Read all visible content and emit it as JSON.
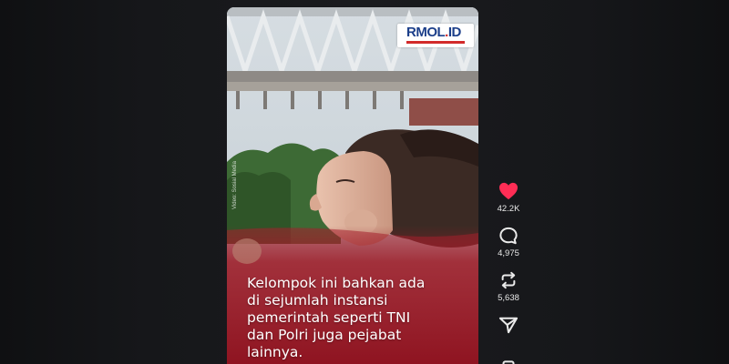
{
  "video": {
    "logo": {
      "main": "RMOL",
      "dot": ".",
      "suffix": "ID"
    },
    "watermark": "Video: Sosial Media",
    "caption_lines": [
      "Kelompok ini bahkan ada",
      "di sejumlah instansi",
      "pemerintah seperti TNI",
      "dan Polri juga pejabat",
      "lainnya."
    ]
  },
  "actions": {
    "like": {
      "icon": "heart-icon",
      "count": "42.2K",
      "color": "#ff2d55"
    },
    "comment": {
      "icon": "comment-icon",
      "count": "4,975"
    },
    "repost": {
      "icon": "repost-icon",
      "count": "5,638"
    },
    "share": {
      "icon": "share-icon"
    },
    "more": {
      "icon": "bookmark-icon"
    }
  }
}
